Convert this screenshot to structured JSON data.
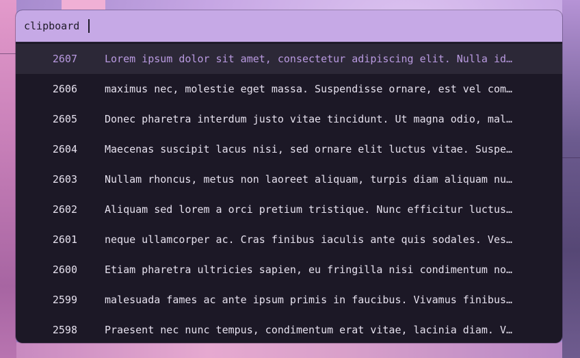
{
  "search": {
    "query": "clipboard"
  },
  "entries": [
    {
      "id": "2607",
      "text": "Lorem ipsum dolor sit amet, consectetur adipiscing elit. Nulla id…",
      "selected": true
    },
    {
      "id": "2606",
      "text": "maximus nec, molestie eget massa. Suspendisse ornare, est vel com…",
      "selected": false
    },
    {
      "id": "2605",
      "text": "Donec pharetra interdum justo vitae tincidunt. Ut magna odio, mal…",
      "selected": false
    },
    {
      "id": "2604",
      "text": "Maecenas suscipit lacus nisi, sed ornare elit luctus vitae. Suspe…",
      "selected": false
    },
    {
      "id": "2603",
      "text": "Nullam rhoncus, metus non laoreet aliquam, turpis diam aliquam nu…",
      "selected": false
    },
    {
      "id": "2602",
      "text": "Aliquam sed lorem a orci pretium tristique. Nunc efficitur luctus…",
      "selected": false
    },
    {
      "id": "2601",
      "text": "neque ullamcorper ac. Cras finibus iaculis ante quis sodales. Ves…",
      "selected": false
    },
    {
      "id": "2600",
      "text": "Etiam pharetra ultricies sapien, eu fringilla nisi condimentum no…",
      "selected": false
    },
    {
      "id": "2599",
      "text": "malesuada fames ac ante ipsum primis in faucibus. Vivamus finibus…",
      "selected": false
    },
    {
      "id": "2598",
      "text": "Praesent nec nunc tempus, condimentum erat vitae, lacinia diam. V…",
      "selected": false
    }
  ],
  "colors": {
    "search_bg": "#c6a9e6",
    "list_bg": "#1c1826",
    "selected_bg": "#2c2837",
    "selected_fg": "#b99ae0",
    "fg": "#e6e1ee"
  }
}
